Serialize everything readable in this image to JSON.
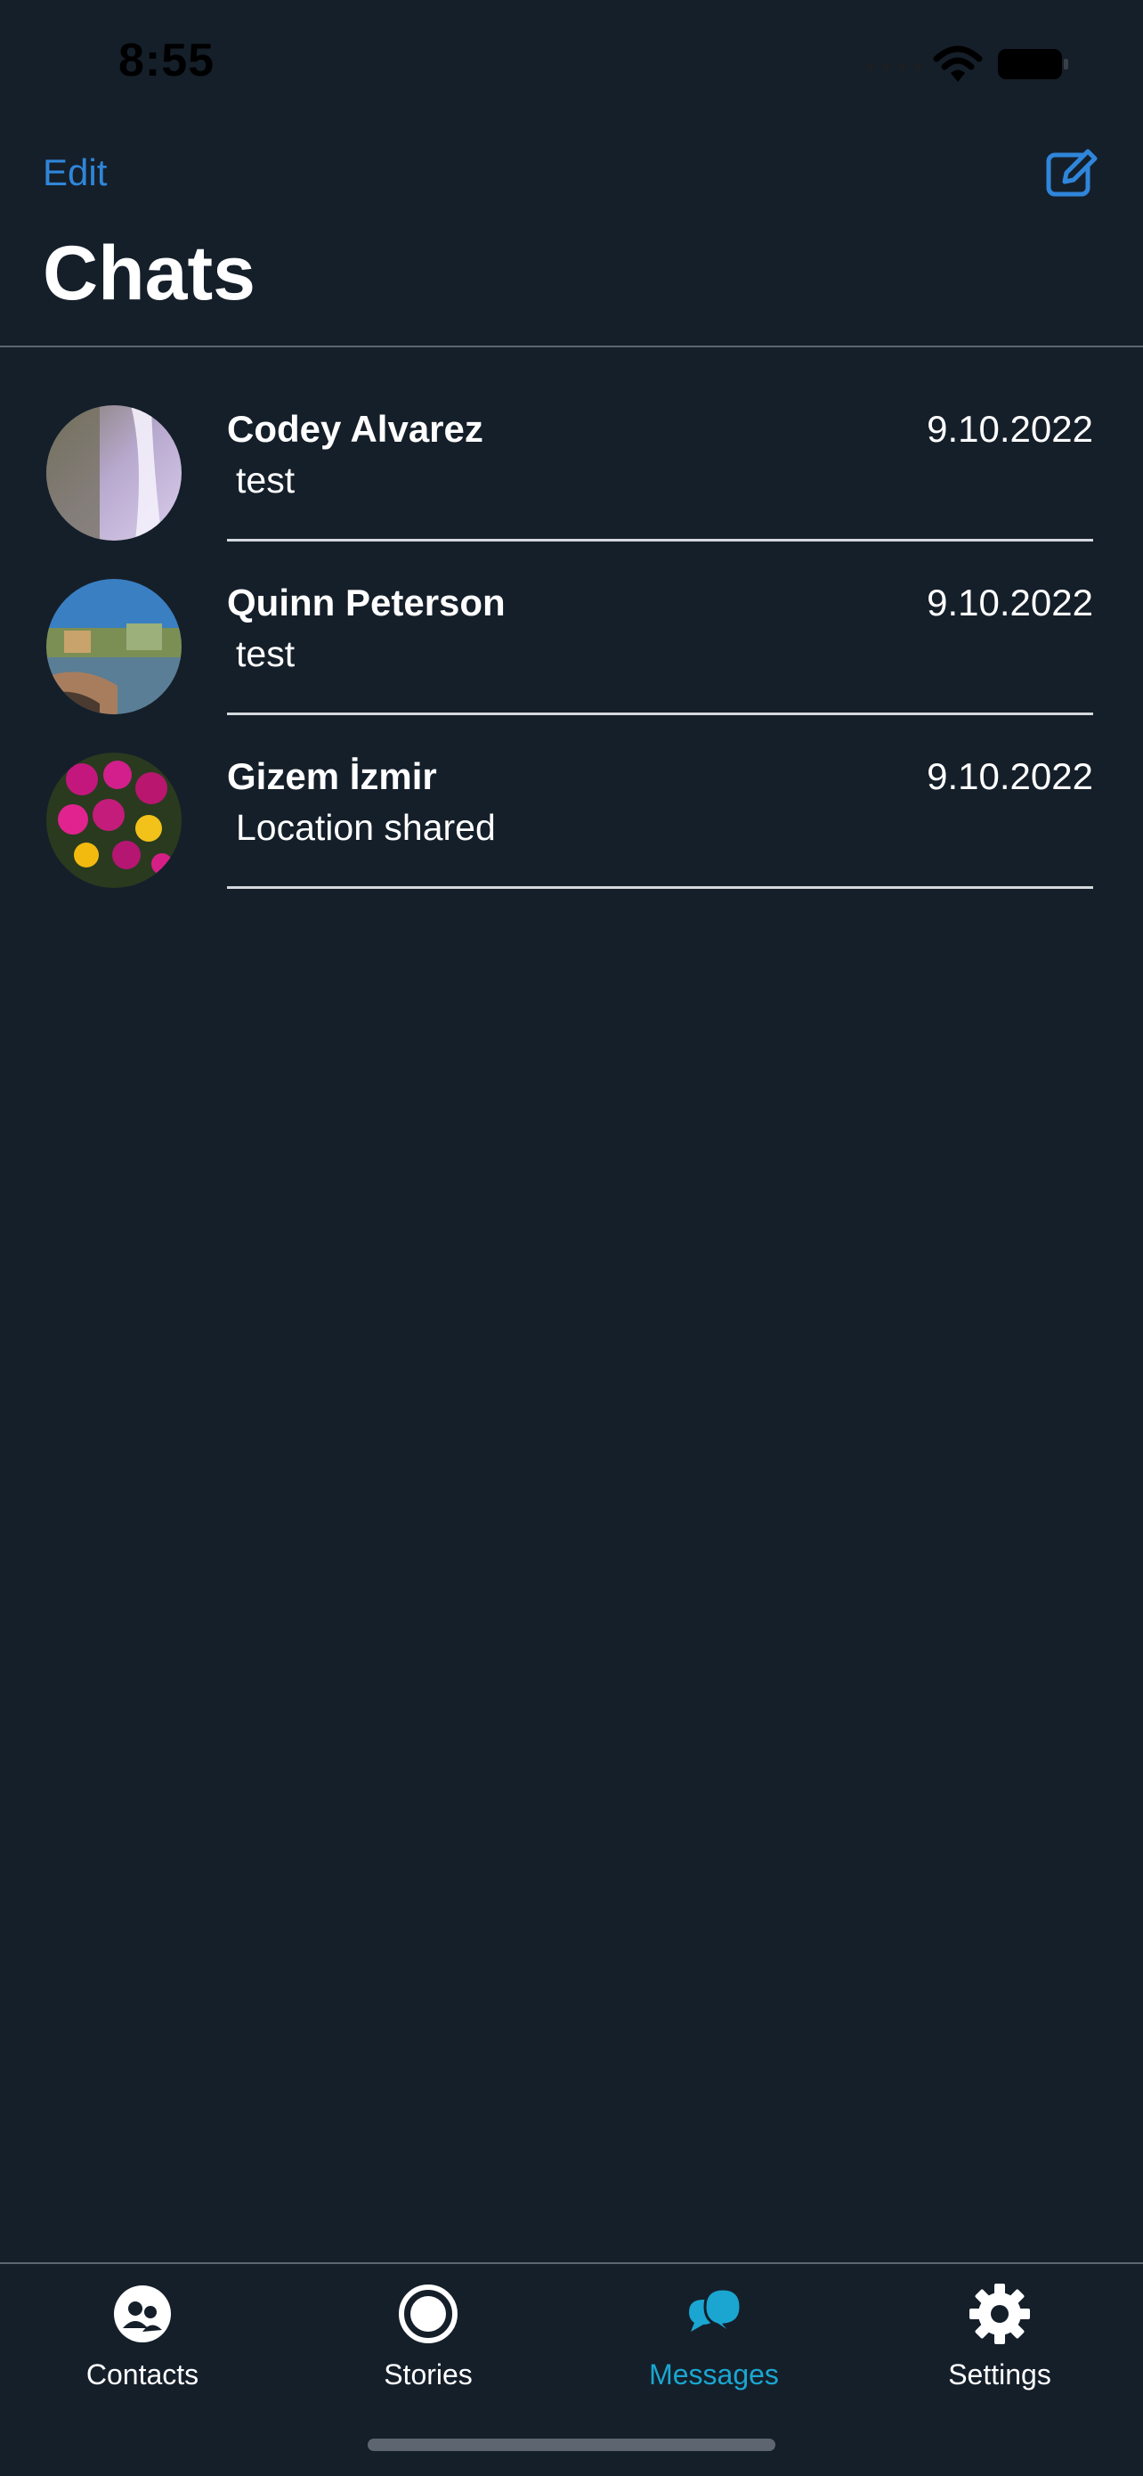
{
  "status_bar": {
    "time": "8:55"
  },
  "header": {
    "edit_label": "Edit",
    "title": "Chats"
  },
  "chats": [
    {
      "name": "Codey Alvarez",
      "date": "9.10.2022",
      "preview": "test"
    },
    {
      "name": "Quinn Peterson",
      "date": "9.10.2022",
      "preview": "test"
    },
    {
      "name": "Gizem İzmir",
      "date": "9.10.2022",
      "preview": "Location shared"
    }
  ],
  "tab_bar": {
    "tabs": [
      {
        "label": "Contacts",
        "icon": "contacts-icon",
        "active": false
      },
      {
        "label": "Stories",
        "icon": "stories-icon",
        "active": false
      },
      {
        "label": "Messages",
        "icon": "messages-icon",
        "active": true
      },
      {
        "label": "Settings",
        "icon": "gear-icon",
        "active": false
      }
    ]
  },
  "colors": {
    "background": "#151f2a",
    "accent": "#2f86da",
    "active_tab": "#1aa6d1",
    "text": "#ffffff"
  }
}
